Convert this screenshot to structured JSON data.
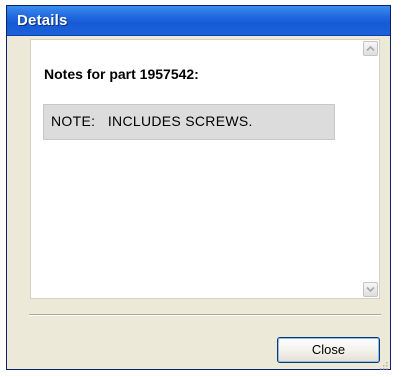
{
  "window": {
    "title": "Details"
  },
  "notes": {
    "heading": "Notes for part 1957542:",
    "note_text": "NOTE:   INCLUDES SCREWS."
  },
  "buttons": {
    "close_label": "Close"
  },
  "icons": {
    "scroll_up": "scroll-up-arrow-icon",
    "scroll_down": "scroll-down-arrow-icon",
    "resize_grip": "resize-grip-icon"
  },
  "colors": {
    "titlebar": "#1f66dd",
    "dialog_background": "#ece9d8",
    "note_background": "#dcdcdc"
  }
}
